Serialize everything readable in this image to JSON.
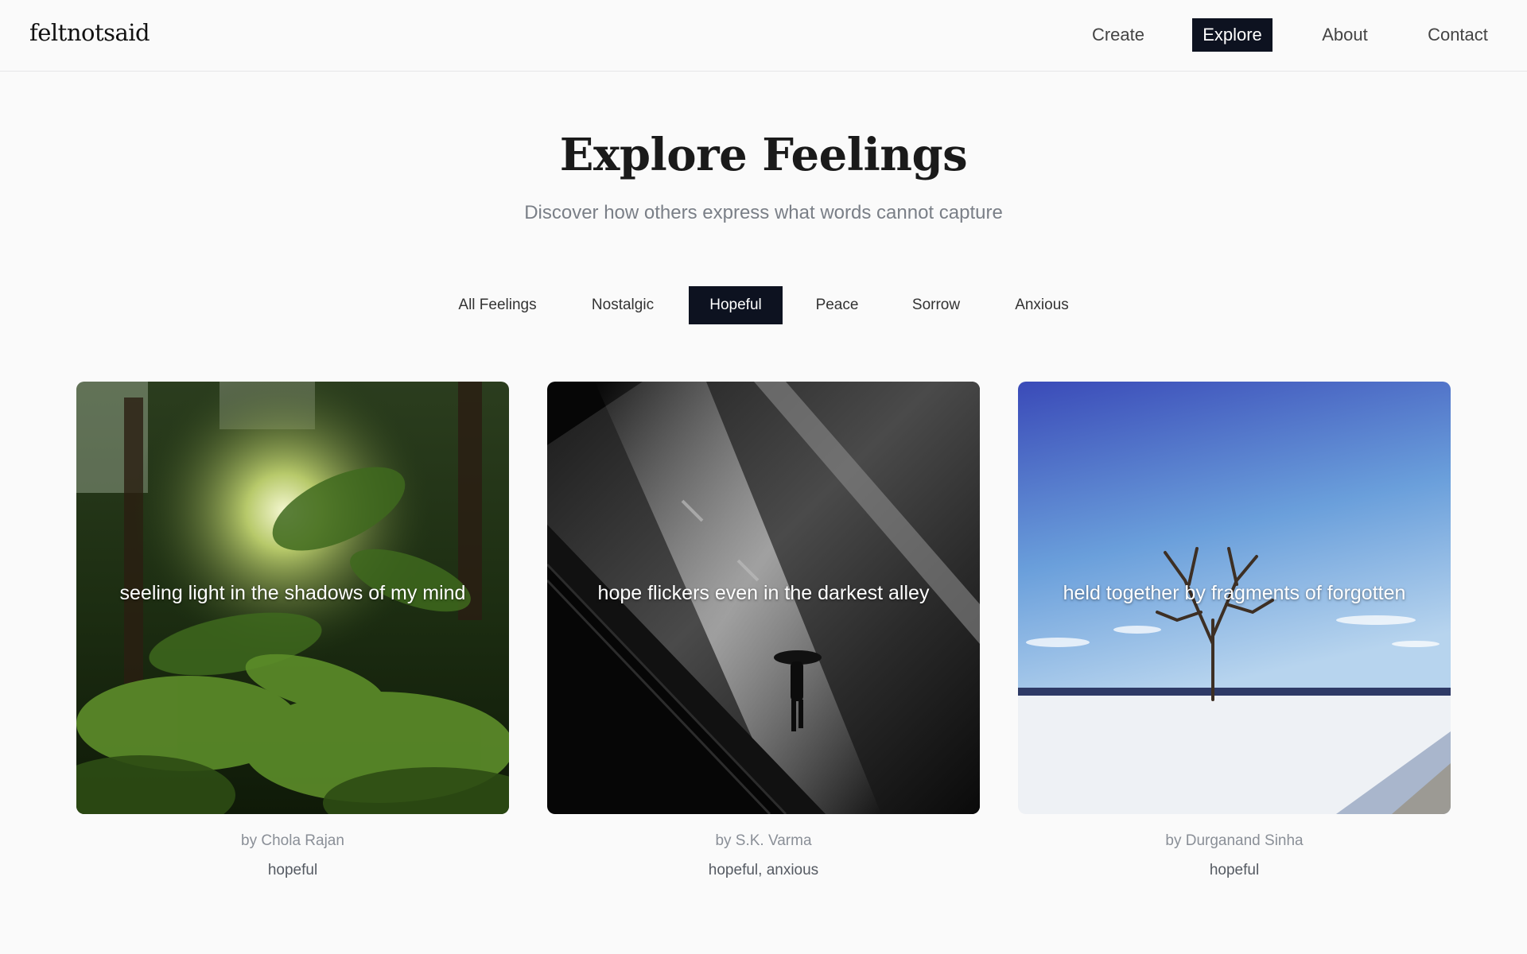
{
  "header": {
    "logo": "feltnotsaid",
    "nav": [
      {
        "label": "Create",
        "active": false
      },
      {
        "label": "Explore",
        "active": true
      },
      {
        "label": "About",
        "active": false
      },
      {
        "label": "Contact",
        "active": false
      }
    ]
  },
  "hero": {
    "title": "Explore Feelings",
    "subtitle": "Discover how others express what words cannot capture"
  },
  "filters": [
    {
      "label": "All Feelings",
      "active": false
    },
    {
      "label": "Nostalgic",
      "active": false
    },
    {
      "label": "Hopeful",
      "active": true
    },
    {
      "label": "Peace",
      "active": false
    },
    {
      "label": "Sorrow",
      "active": false
    },
    {
      "label": "Anxious",
      "active": false
    }
  ],
  "cards": [
    {
      "caption": "seeling light in the shadows of my mind",
      "author": "by Chola Rajan",
      "tags": "hopeful"
    },
    {
      "caption": "hope flickers even in the darkest alley",
      "author": "by S.K. Varma",
      "tags": "hopeful, anxious"
    },
    {
      "caption": "held together by fragments of forgotten",
      "author": "by Durganand Sinha",
      "tags": "hopeful"
    }
  ],
  "colors": {
    "accent": "#0d1220",
    "background": "#fafafa",
    "muted": "#7a7f87"
  }
}
